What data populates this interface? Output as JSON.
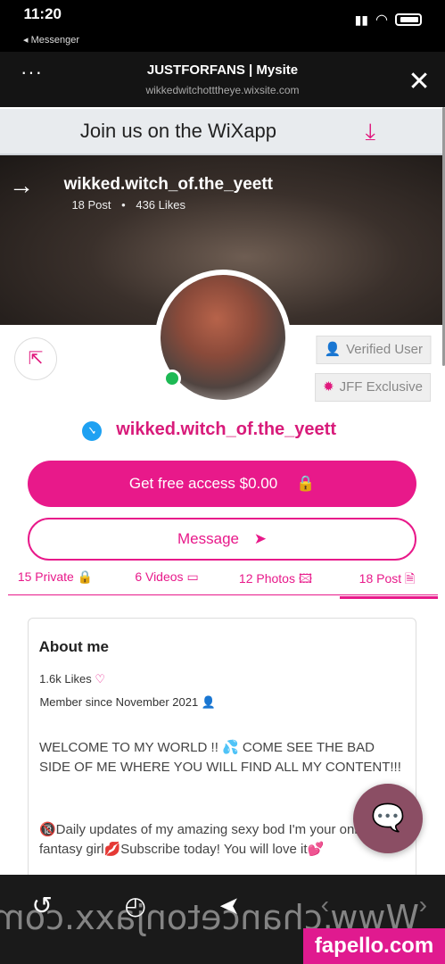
{
  "status_bar": {
    "time": "11:20",
    "back_app": "◂ Messenger"
  },
  "browser": {
    "title": "JUSTFORFANS | Mysite",
    "url": "wikkedwitchotttheye.wixsite.com"
  },
  "wix_banner": {
    "text": "Join us on the WiXapp"
  },
  "cover": {
    "name": "wikked.witch_of.the_yeett",
    "posts": "18 Post",
    "likes": "436 Likes"
  },
  "profile": {
    "badges": [
      "Verified User",
      "JFF Exclusive"
    ],
    "username": "wikked.witch_of.the_yeett",
    "access_button": "Get free access $0.00",
    "message_button": "Message"
  },
  "tabs": [
    "18 Post",
    "12 Photos",
    "6 Videos",
    "15 Private"
  ],
  "about": {
    "title": "About me",
    "likes": "1.6k Likes",
    "member_since": "Member since November 2021",
    "welcome": "WELCOME TO MY WORLD !! 💦 COME SEE THE BAD SIDE OF ME WHERE YOU WILL FIND ALL MY CONTENT!!!",
    "updates": "🔞Daily updates of my amazing sexy bod I'm your online fantasy girl💋Subscribe today! You will love it💕"
  },
  "overlays": {
    "watermark": "Www.chancetonjaxx.com",
    "source_badge": "fapello.com"
  },
  "colors": {
    "accent": "#e8198a",
    "online": "#1db954",
    "verified": "#1ea1f2"
  }
}
